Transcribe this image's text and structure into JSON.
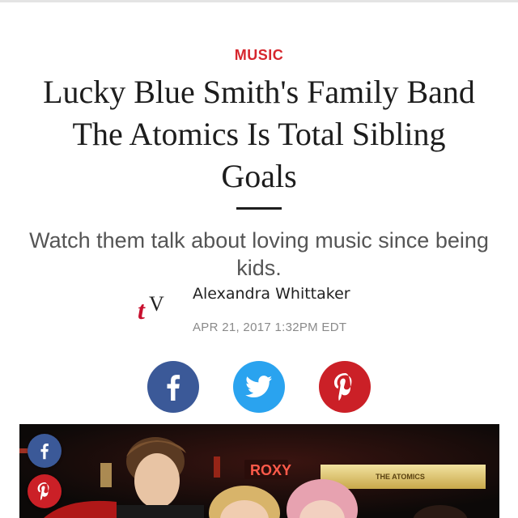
{
  "article": {
    "category": "MUSIC",
    "headline": "Lucky Blue Smith's Family Band The Atomics Is Total Sibling Goals",
    "dek": "Watch them talk about loving music since being kids.",
    "author": "Alexandra Whittaker",
    "date": "APR 21, 2017 1:32PM EDT",
    "author_logo": {
      "letters": [
        "t",
        "V"
      ],
      "icon": "teen-vogue-logo"
    }
  },
  "share": {
    "buttons": [
      {
        "network": "facebook",
        "icon": "facebook-icon",
        "color": "#3b5998"
      },
      {
        "network": "twitter",
        "icon": "twitter-icon",
        "color": "#2aa3ef"
      },
      {
        "network": "pinterest",
        "icon": "pinterest-icon",
        "color": "#cb2027"
      }
    ]
  },
  "hero": {
    "signs": [
      "ROXY",
      "THE ATOMICS"
    ],
    "floating_share": [
      {
        "network": "facebook",
        "icon": "facebook-icon"
      },
      {
        "network": "pinterest",
        "icon": "pinterest-icon"
      }
    ]
  },
  "colors": {
    "accent": "#d6262d",
    "facebook": "#3b5998",
    "twitter": "#2aa3ef",
    "pinterest": "#cb2027"
  }
}
